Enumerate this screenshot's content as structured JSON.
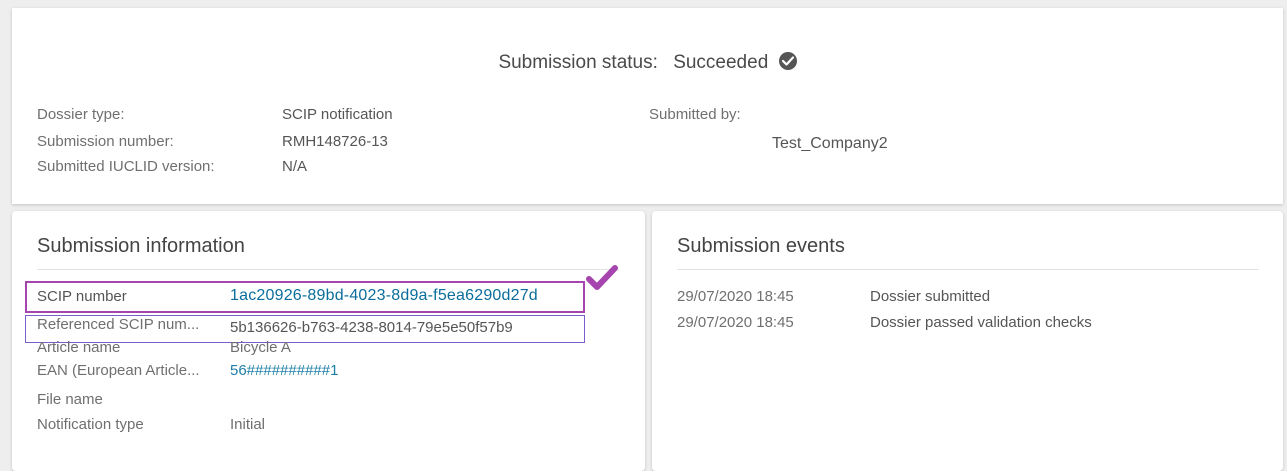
{
  "status": {
    "label": "Submission status:",
    "value": "Succeeded",
    "icon": "check-circle-icon"
  },
  "dossier": {
    "type_label": "Dossier type:",
    "type_value": "SCIP notification",
    "number_label": "Submission number:",
    "number_value": "RMH148726-13",
    "iuclid_label": "Submitted IUCLID version:",
    "iuclid_value": "N/A",
    "submitted_by_label": "Submitted by:",
    "submitted_by_value": "Test_Company2"
  },
  "info": {
    "title": "Submission information",
    "scip_label": "SCIP number",
    "scip_value": "1ac20926-89bd-4023-8d9a-f5ea6290d27d",
    "ref_label": "Referenced SCIP num...",
    "ref_value": "5b136626-b763-4238-8014-79e5e50f57b9",
    "article_label": "Article name",
    "article_value": "Bicycle A",
    "ean_label": "EAN (European Article...",
    "ean_value": "56##########1",
    "file_label": "File name",
    "file_value": "",
    "notif_label": "Notification type",
    "notif_value": "Initial"
  },
  "events": {
    "title": "Submission events",
    "rows": [
      {
        "time": "29/07/2020 18:45",
        "text": "Dossier submitted"
      },
      {
        "time": "29/07/2020 18:45",
        "text": "Dossier passed validation checks"
      }
    ]
  },
  "colors": {
    "highlight_purple": "#a545ad",
    "highlight_blue": "#7a5fcc",
    "link": "#0a6d9b"
  }
}
